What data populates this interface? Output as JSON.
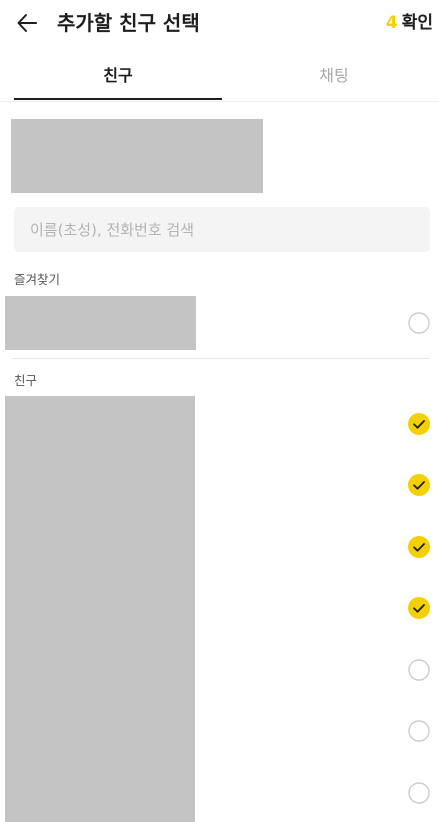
{
  "header": {
    "title": "추가할 친구 선택",
    "selected_count": "4",
    "confirm_label": "확인",
    "back_icon": "arrow-left-icon"
  },
  "tabs": [
    {
      "label": "친구",
      "active": true
    },
    {
      "label": "채팅",
      "active": false
    }
  ],
  "search": {
    "placeholder": "이름(초성), 전화번호 검색",
    "value": ""
  },
  "favorites": {
    "label": "즐겨찾기",
    "items": [
      {
        "selected": false
      }
    ]
  },
  "friends": {
    "label": "친구",
    "items": [
      {
        "selected": true
      },
      {
        "selected": true
      },
      {
        "selected": true
      },
      {
        "selected": true
      },
      {
        "selected": false
      },
      {
        "selected": false
      },
      {
        "selected": false
      }
    ]
  },
  "colors": {
    "accent": "#f5d000",
    "check_mark": "#1e1e1e",
    "unchecked_border": "#cccccc",
    "redacted": "#c4c4c4"
  }
}
